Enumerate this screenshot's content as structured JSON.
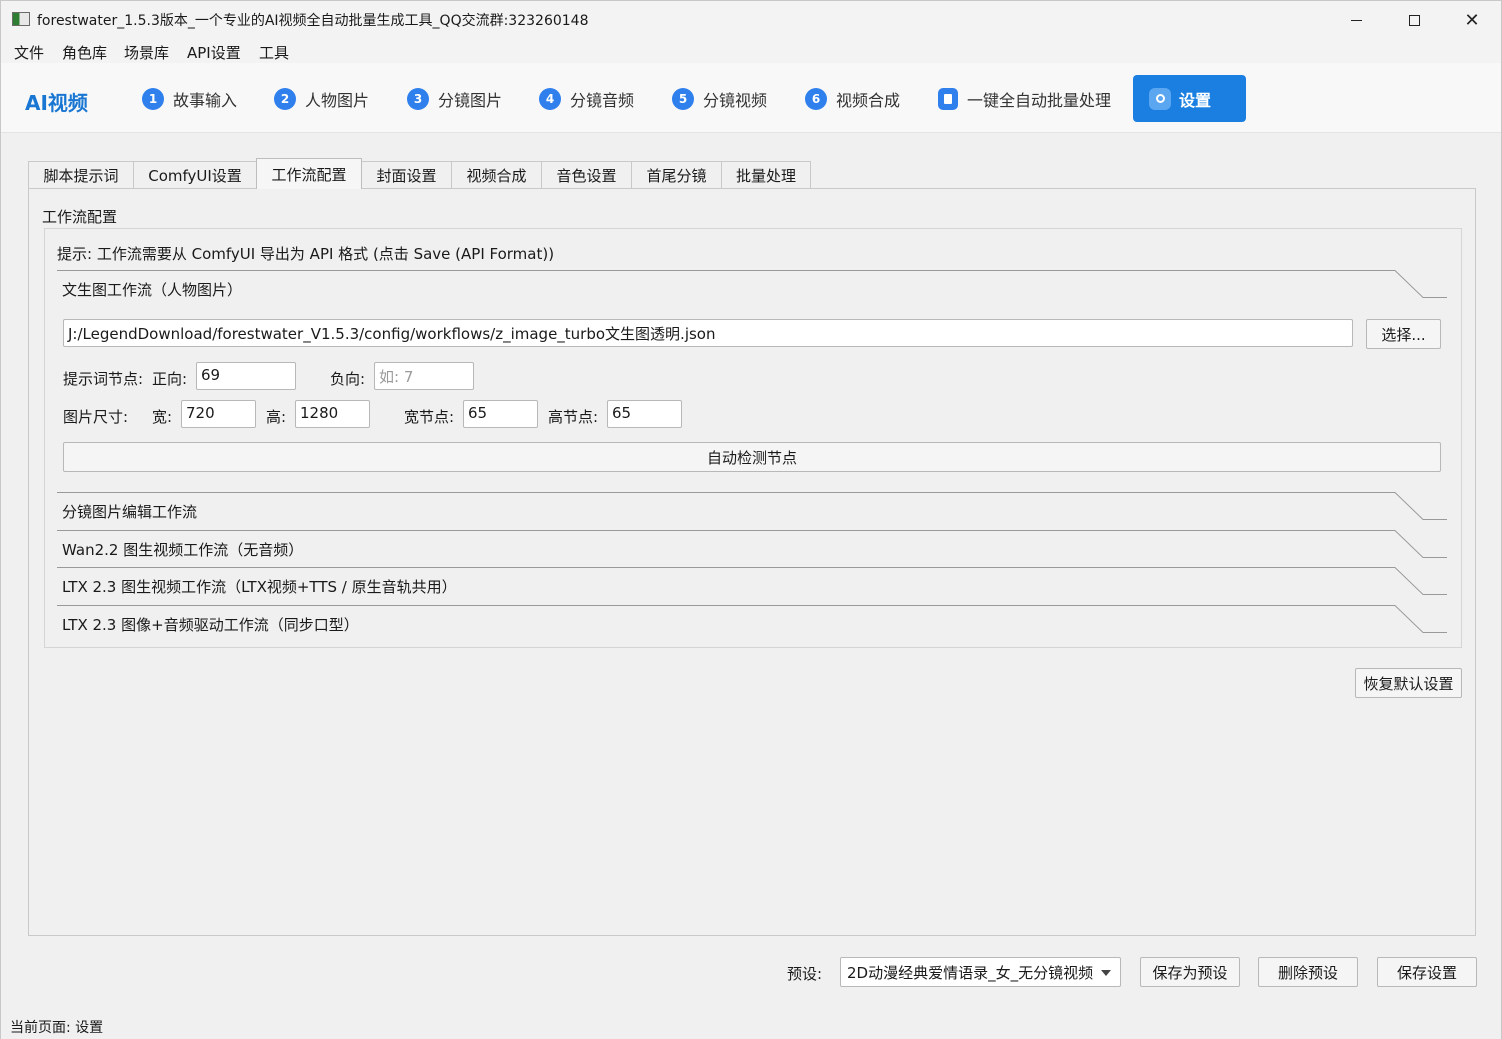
{
  "window": {
    "title": "forestwater_1.5.3版本_一个专业的AI视频全自动批量生成工具_QQ交流群:323260148"
  },
  "menu": [
    "文件",
    "角色库",
    "场景库",
    "API设置",
    "工具"
  ],
  "nav": {
    "brand": "AI视频",
    "steps": [
      {
        "num": "1",
        "label": "故事输入"
      },
      {
        "num": "2",
        "label": "人物图片"
      },
      {
        "num": "3",
        "label": "分镜图片"
      },
      {
        "num": "4",
        "label": "分镜音频"
      },
      {
        "num": "5",
        "label": "分镜视频"
      },
      {
        "num": "6",
        "label": "视频合成"
      }
    ],
    "batch_label": "一键全自动批量处理",
    "active_label": "设置",
    "accent": "#1a7fe0"
  },
  "tabs": [
    "脚本提示词",
    "ComfyUI设置",
    "工作流配置",
    "封面设置",
    "视频合成",
    "音色设置",
    "首尾分镜",
    "批量处理"
  ],
  "active_tab": "工作流配置",
  "workflow": {
    "panel_title": "工作流配置",
    "hint": "提示: 工作流需要从 ComfyUI 导出为 API 格式 (点击 Save (API Format))",
    "t2i_section": "文生图工作流（人物图片）",
    "path_value": "J:/LegendDownload/forestwater_V1.5.3/config/workflows/z_image_turbo文生图透明.json",
    "browse_label": "选择...",
    "prompt_nodes_label": "提示词节点:",
    "positive_label": "正向:",
    "positive_value": "69",
    "negative_label": "负向:",
    "negative_placeholder": "如: 7",
    "size_label": "图片尺寸:",
    "width_label": "宽:",
    "width_value": "720",
    "height_label": "高:",
    "height_value": "1280",
    "width_node_label": "宽节点:",
    "width_node_value": "65",
    "height_node_label": "高节点:",
    "height_node_value": "65",
    "detect_label": "自动检测节点",
    "sections": [
      "分镜图片编辑工作流",
      "Wan2.2 图生视频工作流（无音频）",
      "LTX 2.3 图生视频工作流（LTX视频+TTS / 原生音轨共用）",
      "LTX 2.3 图像+音频驱动工作流（同步口型）"
    ],
    "restore_label": "恢复默认设置"
  },
  "footer": {
    "preset_label": "预设:",
    "preset_value": "2D动漫经典爱情语录_女_无分镜视频",
    "save_preset_label": "保存为预设",
    "delete_preset_label": "删除预设",
    "save_settings_label": "保存设置"
  },
  "status": {
    "text": "当前页面: 设置"
  }
}
